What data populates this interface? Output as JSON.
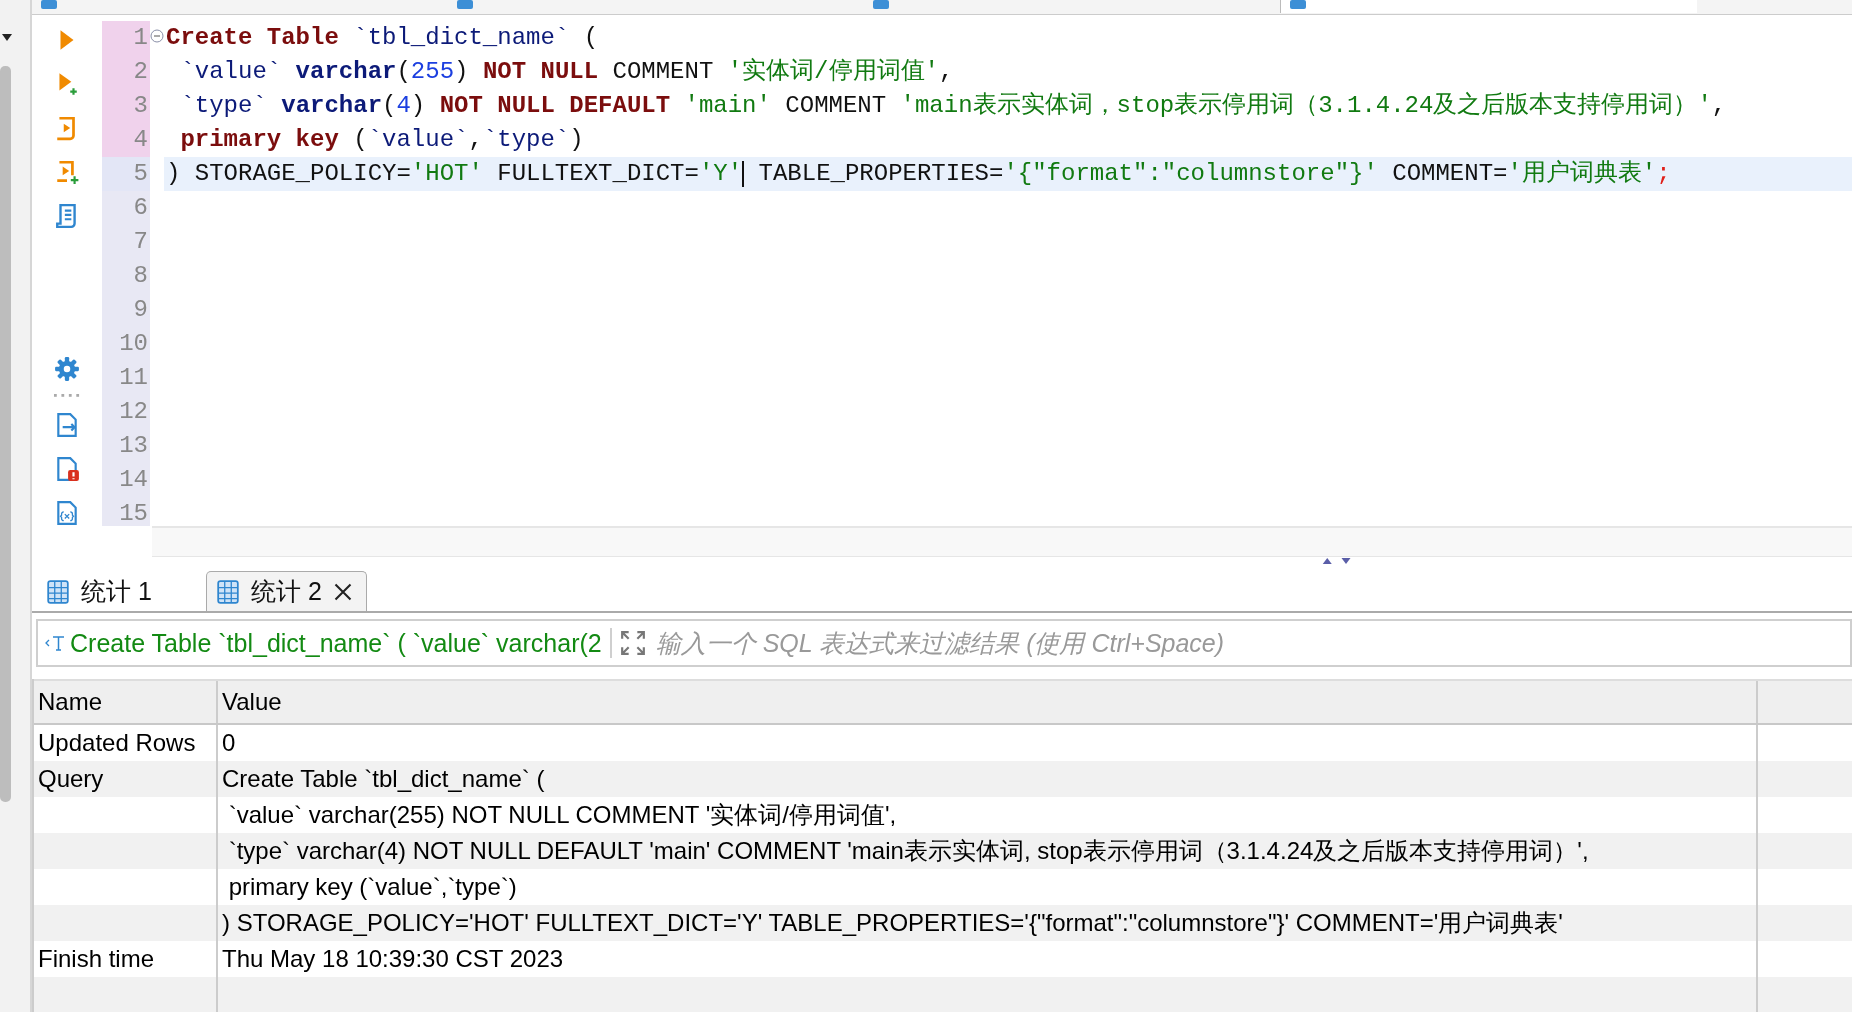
{
  "editor": {
    "lines": [
      {
        "number": "1",
        "collapsible": true,
        "in_statement": true,
        "selected": false,
        "tokens": [
          {
            "kind": "kw",
            "text": "Create Table"
          },
          {
            "kind": "id",
            "text": " `tbl_dict_name`"
          },
          {
            "kind": "plain",
            "text": " ("
          }
        ]
      },
      {
        "number": "2",
        "collapsible": false,
        "in_statement": true,
        "selected": false,
        "tokens": [
          {
            "kind": "id",
            "text": " `value`"
          },
          {
            "kind": "type",
            "text": " varchar"
          },
          {
            "kind": "plain",
            "text": "("
          },
          {
            "kind": "num",
            "text": "255"
          },
          {
            "kind": "plain",
            "text": ") "
          },
          {
            "kind": "kw",
            "text": "NOT NULL"
          },
          {
            "kind": "plain",
            "text": " COMMENT "
          },
          {
            "kind": "str",
            "text": "'实体词/停用词值'"
          },
          {
            "kind": "plain",
            "text": ","
          }
        ]
      },
      {
        "number": "3",
        "collapsible": false,
        "in_statement": true,
        "selected": false,
        "tokens": [
          {
            "kind": "id",
            "text": " `type`"
          },
          {
            "kind": "type",
            "text": " varchar"
          },
          {
            "kind": "plain",
            "text": "("
          },
          {
            "kind": "num",
            "text": "4"
          },
          {
            "kind": "plain",
            "text": ") "
          },
          {
            "kind": "kw",
            "text": "NOT NULL DEFAULT"
          },
          {
            "kind": "str",
            "text": " 'main'"
          },
          {
            "kind": "plain",
            "text": " COMMENT "
          },
          {
            "kind": "str",
            "text": "'main表示实体词，stop表示停用词（3.1.4.24及之后版本支持停用词）'"
          },
          {
            "kind": "plain",
            "text": ","
          }
        ]
      },
      {
        "number": "4",
        "collapsible": false,
        "in_statement": true,
        "selected": false,
        "tokens": [
          {
            "kind": "kw",
            "text": " primary key"
          },
          {
            "kind": "plain",
            "text": " ("
          },
          {
            "kind": "id",
            "text": "`value`"
          },
          {
            "kind": "plain",
            "text": ","
          },
          {
            "kind": "id",
            "text": "`type`"
          },
          {
            "kind": "plain",
            "text": ")"
          }
        ]
      },
      {
        "number": "5",
        "collapsible": false,
        "in_statement": false,
        "selected": true,
        "tokens": [
          {
            "kind": "plain",
            "text": ") STORAGE_POLICY="
          },
          {
            "kind": "str",
            "text": "'HOT'"
          },
          {
            "kind": "plain",
            "text": " FULLTEXT_DICT="
          },
          {
            "kind": "str",
            "text": "'Y'"
          },
          {
            "kind": "caret"
          },
          {
            "kind": "plain",
            "text": " TABLE_PROPERTIES="
          },
          {
            "kind": "str",
            "text": "'{\"format\":\"columnstore\"}'"
          },
          {
            "kind": "plain",
            "text": " COMMENT="
          },
          {
            "kind": "str",
            "text": "'用户词典表'"
          },
          {
            "kind": "end",
            "text": ";"
          }
        ]
      },
      {
        "number": "6",
        "collapsible": false,
        "in_statement": false,
        "selected": false
      },
      {
        "number": "7",
        "collapsible": false,
        "in_statement": false,
        "selected": false
      },
      {
        "number": "8",
        "collapsible": false,
        "in_statement": false,
        "selected": false
      },
      {
        "number": "9",
        "collapsible": false,
        "in_statement": false,
        "selected": false
      },
      {
        "number": "10",
        "collapsible": false,
        "in_statement": false,
        "selected": false
      },
      {
        "number": "11",
        "collapsible": false,
        "in_statement": false,
        "selected": false
      },
      {
        "number": "12",
        "collapsible": false,
        "in_statement": false,
        "selected": false
      },
      {
        "number": "13",
        "collapsible": false,
        "in_statement": false,
        "selected": false
      },
      {
        "number": "14",
        "collapsible": false,
        "in_statement": false,
        "selected": false
      },
      {
        "number": "15",
        "collapsible": false,
        "in_statement": false,
        "selected": false
      }
    ]
  },
  "editor_tabs": [
    {
      "selected": false
    },
    {
      "selected": false
    },
    {
      "selected": false
    },
    {
      "selected": true
    }
  ],
  "result_tabs": [
    {
      "label": "统计 1",
      "selected": false,
      "closable": false
    },
    {
      "label": "统计 2",
      "selected": true,
      "closable": true
    }
  ],
  "filter": {
    "query": "Create Table `tbl_dict_name` ( `value` varchar(2",
    "placeholder": "输入一个 SQL 表达式来过滤结果 (使用 Ctrl+Space)"
  },
  "table": {
    "columns": [
      "Name",
      "Value"
    ],
    "rows": [
      {
        "name": "Updated Rows",
        "lines": [
          "0"
        ]
      },
      {
        "name": "Query",
        "lines": [
          "Create Table `tbl_dict_name` (",
          " `value` varchar(255) NOT NULL COMMENT '实体词/停用词值',",
          " `type` varchar(4) NOT NULL DEFAULT 'main' COMMENT 'main表示实体词, stop表示停用词（3.1.4.24及之后版本支持停用词）',",
          " primary key (`value`,`type`)",
          ") STORAGE_POLICY='HOT' FULLTEXT_DICT='Y' TABLE_PROPERTIES='{\"format\":\"columnstore\"}' COMMENT='用户词典表'"
        ]
      },
      {
        "name": "Finish time",
        "lines": [
          "Thu May 18 10:39:30 CST 2023"
        ]
      }
    ]
  }
}
